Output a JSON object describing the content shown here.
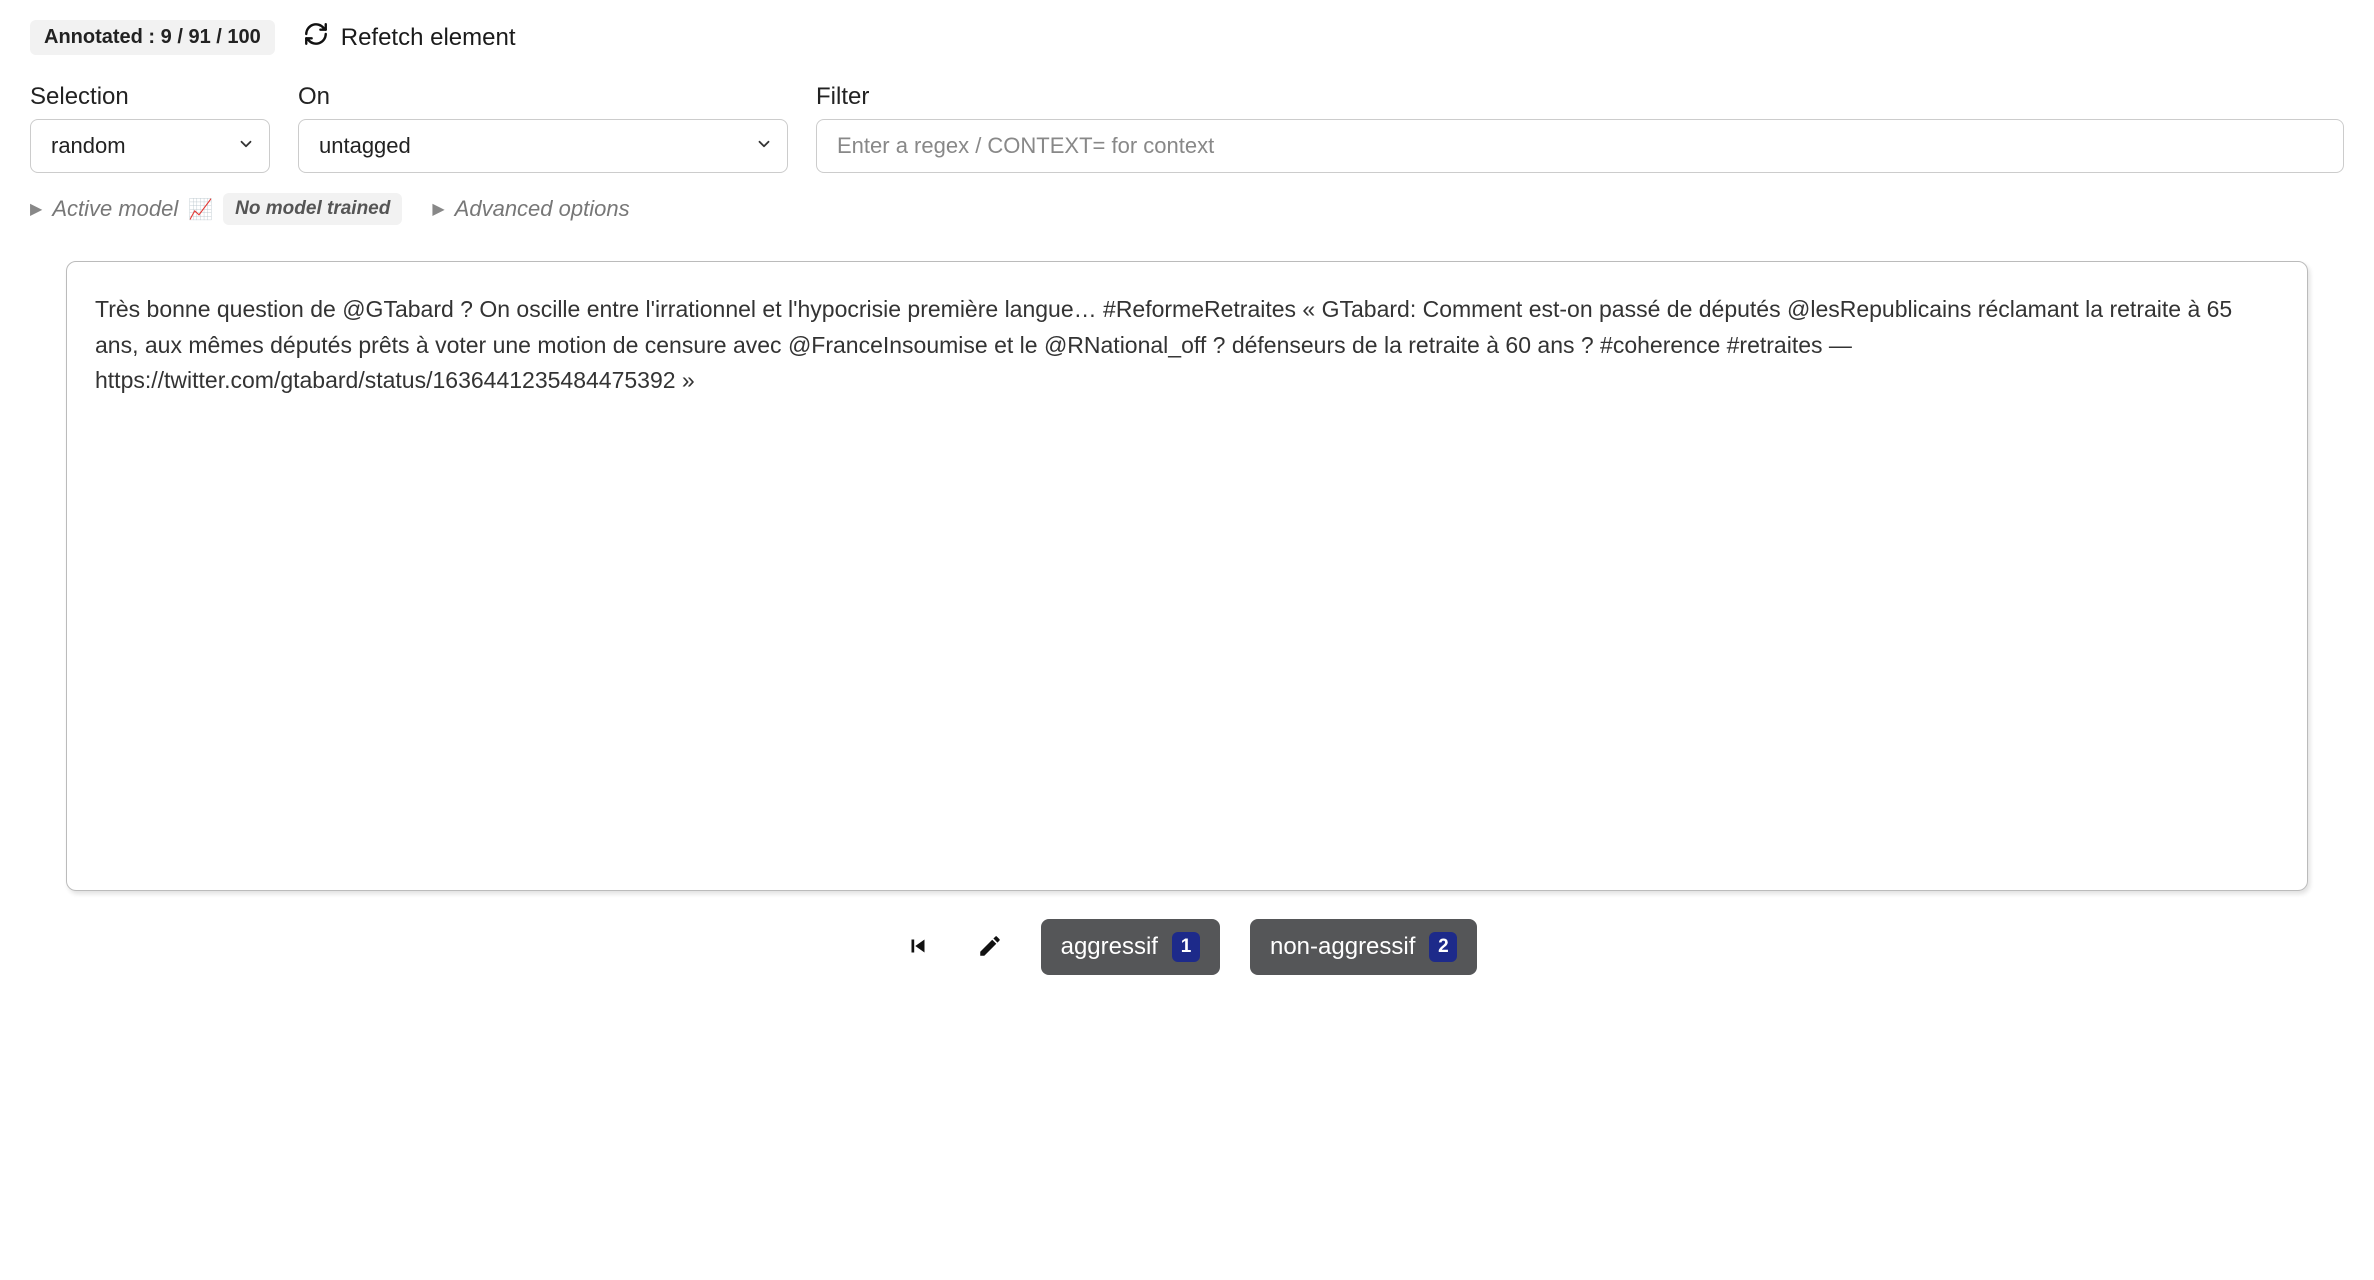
{
  "header": {
    "annotated_label": "Annotated : 9 / 91 / 100",
    "refetch_label": "Refetch element"
  },
  "controls": {
    "selection": {
      "label": "Selection",
      "value": "random"
    },
    "on": {
      "label": "On",
      "value": "untagged"
    },
    "filter": {
      "label": "Filter",
      "placeholder": "Enter a regex / CONTEXT= for context",
      "value": ""
    }
  },
  "meta": {
    "active_model_label": "Active model",
    "no_model_badge": "No model trained",
    "advanced_options_label": "Advanced options"
  },
  "content": {
    "text": "Très bonne question de @GTabard ? On oscille entre l'irrationnel et l'hypocrisie première langue… #ReformeRetraites « GTabard: Comment est-on passé de députés @lesRepublicains réclamant la retraite à 65 ans, aux mêmes députés prêts à voter une motion de censure avec @FranceInsoumise et le @RNational_off ? défenseurs de la retraite à  60 ans ? #coherence #retraites — https://twitter.com/gtabard/status/1636441235484475392 »"
  },
  "actions": {
    "tags": [
      {
        "label": "aggressif",
        "key": "1"
      },
      {
        "label": "non-aggressif",
        "key": "2"
      }
    ]
  }
}
